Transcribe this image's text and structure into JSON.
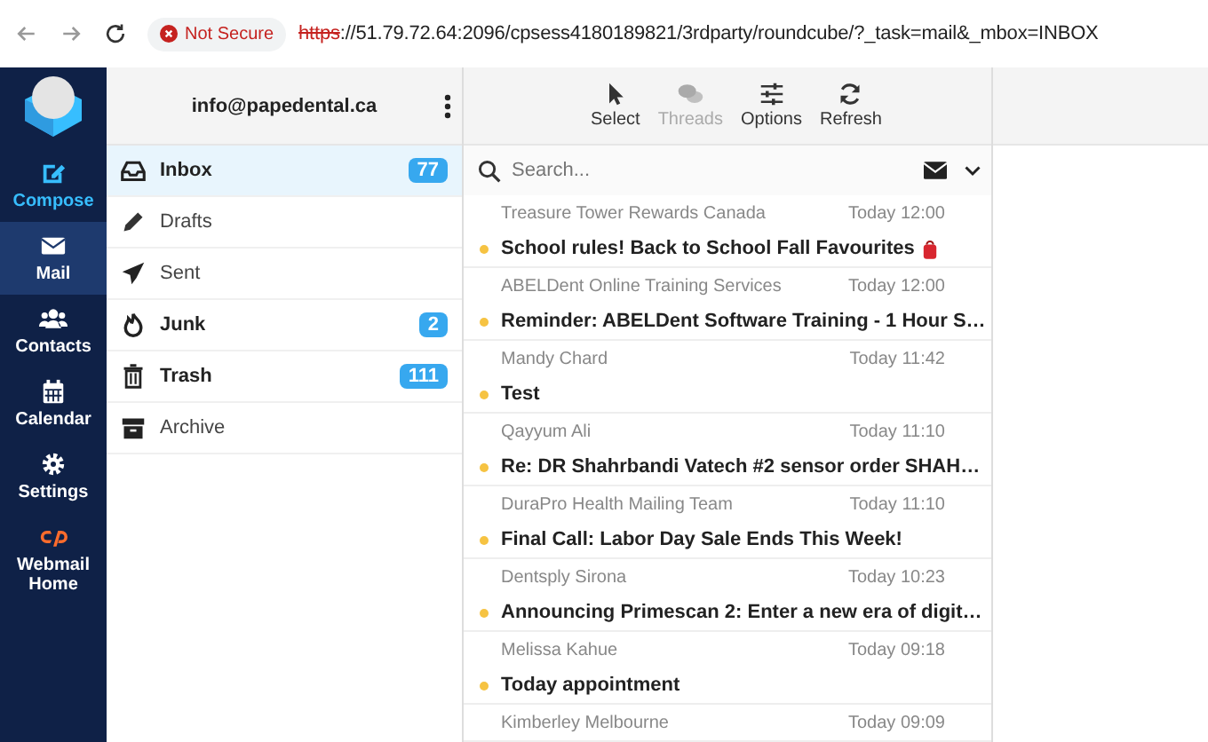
{
  "browser": {
    "security": "Not Secure",
    "url_scheme": "https",
    "url_rest": "://51.79.72.64:2096/cpsess4180189821/3rdparty/roundcube/?_task=mail&_mbox=INBOX"
  },
  "nav": [
    {
      "kind": "compose",
      "label": "Compose",
      "selected": false
    },
    {
      "kind": "mail",
      "label": "Mail",
      "selected": true
    },
    {
      "kind": "contacts",
      "label": "Contacts",
      "selected": false
    },
    {
      "kind": "calendar",
      "label": "Calendar",
      "selected": false
    },
    {
      "kind": "settings",
      "label": "Settings",
      "selected": false
    },
    {
      "kind": "cpanel",
      "label": "Webmail Home",
      "selected": false
    }
  ],
  "account": "info@papedental.ca",
  "folders": [
    {
      "kind": "inbox",
      "label": "Inbox",
      "count": "77",
      "selected": true,
      "unread": true
    },
    {
      "kind": "drafts",
      "label": "Drafts",
      "selected": false,
      "unread": false
    },
    {
      "kind": "sent",
      "label": "Sent",
      "selected": false,
      "unread": false
    },
    {
      "kind": "junk",
      "label": "Junk",
      "count": "2",
      "selected": false,
      "unread": true
    },
    {
      "kind": "trash",
      "label": "Trash",
      "count": "111",
      "selected": false,
      "unread": true
    },
    {
      "kind": "archive",
      "label": "Archive",
      "selected": false,
      "unread": false
    }
  ],
  "toolbar": [
    {
      "kind": "select",
      "label": "Select",
      "disabled": false
    },
    {
      "kind": "threads",
      "label": "Threads",
      "disabled": true
    },
    {
      "kind": "options",
      "label": "Options",
      "disabled": false
    },
    {
      "kind": "refresh",
      "label": "Refresh",
      "disabled": false
    }
  ],
  "search": {
    "placeholder": "Search..."
  },
  "messages": [
    {
      "sender": "Treasure Tower Rewards Canada",
      "date": "Today 12:00",
      "subject": "School rules! Back to School Fall Favourites",
      "unread": true,
      "flag_emoji": true
    },
    {
      "sender": "ABELDent Online Training Services",
      "date": "Today 12:00",
      "subject": "Reminder: ABELDent Software Training - 1 Hour S…",
      "unread": true
    },
    {
      "sender": "Mandy Chard",
      "date": "Today 11:42",
      "subject": "Test",
      "unread": true
    },
    {
      "sender": "Qayyum Ali",
      "date": "Today 11:10",
      "subject": "Re: DR Shahrbandi Vatech #2 sensor order SHAH…",
      "unread": true
    },
    {
      "sender": "DuraPro Health Mailing Team",
      "date": "Today 11:10",
      "subject": "Final Call: Labor Day Sale Ends This Week!",
      "unread": true
    },
    {
      "sender": "Dentsply Sirona",
      "date": "Today 10:23",
      "subject": "Announcing Primescan 2: Enter a new era of digit…",
      "unread": true
    },
    {
      "sender": "Melissa Kahue",
      "date": "Today 09:18",
      "subject": "Today appointment",
      "unread": true
    },
    {
      "sender": "Kimberley Melbourne",
      "date": "Today 09:09"
    }
  ]
}
